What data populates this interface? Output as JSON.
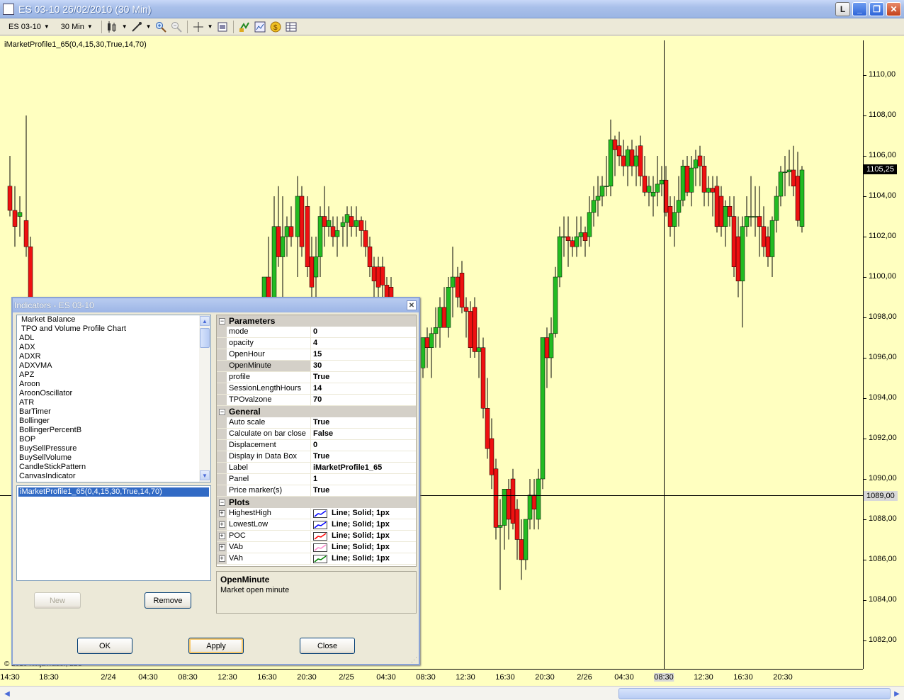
{
  "window": {
    "title": "ES 03-10  26/02/2010 (30 Min)",
    "buttons": [
      "L",
      "_",
      "❐",
      "✕"
    ]
  },
  "toolbar": {
    "instrument": "ES 03-10",
    "interval": "30 Min"
  },
  "chart": {
    "indicator_label": "iMarketProfile1_65(0,4,15,30,True,14,70)",
    "copyright": "© 2010 NinjaTrader, LLC",
    "price_labels": [
      "1110,00",
      "1108,00",
      "1106,00",
      "1104,00",
      "1102,00",
      "1100,00",
      "1098,00",
      "1096,00",
      "1094,00",
      "1092,00",
      "1090,00",
      "1088,00",
      "1086,00",
      "1084,00",
      "1082,00"
    ],
    "last_price": "1105,25",
    "crosshair_price": "1089,00",
    "crosshair_time": "08:30",
    "time_labels": [
      "14:30",
      "18:30",
      "2/24",
      "04:30",
      "08:30",
      "12:30",
      "16:30",
      "20:30",
      "2/25",
      "04:30",
      "08:30",
      "12:30",
      "16:30",
      "20:30",
      "2/26",
      "04:30",
      "08:30",
      "12:30",
      "16:30",
      "20:30"
    ],
    "colors": {
      "background": "#ffffc0",
      "up": "#22bb22",
      "down": "#ee1111",
      "wick": "#000000"
    }
  },
  "dialog": {
    "title": "Indicators - ES 03-10",
    "indicators": [
      "Market Balance",
      "TPO and Volume Profile Chart",
      "ADL",
      "ADX",
      "ADXR",
      "ADXVMA",
      "APZ",
      "Aroon",
      "AroonOscillator",
      "ATR",
      "BarTimer",
      "Bollinger",
      "BollingerPercentB",
      "BOP",
      "BuySellPressure",
      "BuySellVolume",
      "CandleStickPattern",
      "CanvasIndicator"
    ],
    "applied": "iMarketProfile1_65(0,4,15,30,True,14,70)",
    "new_label": "New",
    "remove_label": "Remove",
    "ok_label": "OK",
    "apply_label": "Apply",
    "close_label": "Close",
    "parameters_title": "Parameters",
    "parameters": [
      {
        "name": "mode",
        "value": "0"
      },
      {
        "name": "opacity",
        "value": "4"
      },
      {
        "name": "OpenHour",
        "value": "15"
      },
      {
        "name": "OpenMinute",
        "value": "30"
      },
      {
        "name": "profile",
        "value": "True"
      },
      {
        "name": "SessionLengthHours",
        "value": "14"
      },
      {
        "name": "TPOvalzone",
        "value": "70"
      }
    ],
    "general_title": "General",
    "general": [
      {
        "name": "Auto scale",
        "value": "True"
      },
      {
        "name": "Calculate on bar close",
        "value": "False"
      },
      {
        "name": "Displacement",
        "value": "0"
      },
      {
        "name": "Display in Data Box",
        "value": "True"
      },
      {
        "name": "Label",
        "value": "iMarketProfile1_65"
      },
      {
        "name": "Panel",
        "value": "1"
      },
      {
        "name": "Price marker(s)",
        "value": "True"
      }
    ],
    "plots_title": "Plots",
    "plots": [
      {
        "name": "HighestHigh",
        "value": "Line; Solid; 1px",
        "color": "#0000ff"
      },
      {
        "name": "LowestLow",
        "value": "Line; Solid; 1px",
        "color": "#0000ff"
      },
      {
        "name": "POC",
        "value": "Line; Solid; 1px",
        "color": "#ff0000"
      },
      {
        "name": "VAb",
        "value": "Line; Solid; 1px",
        "color": "#ff88cc"
      },
      {
        "name": "VAh",
        "value": "Line; Solid; 1px",
        "color": "#008000"
      }
    ],
    "help_title": "OpenMinute",
    "help_text": "Market open minute"
  }
}
